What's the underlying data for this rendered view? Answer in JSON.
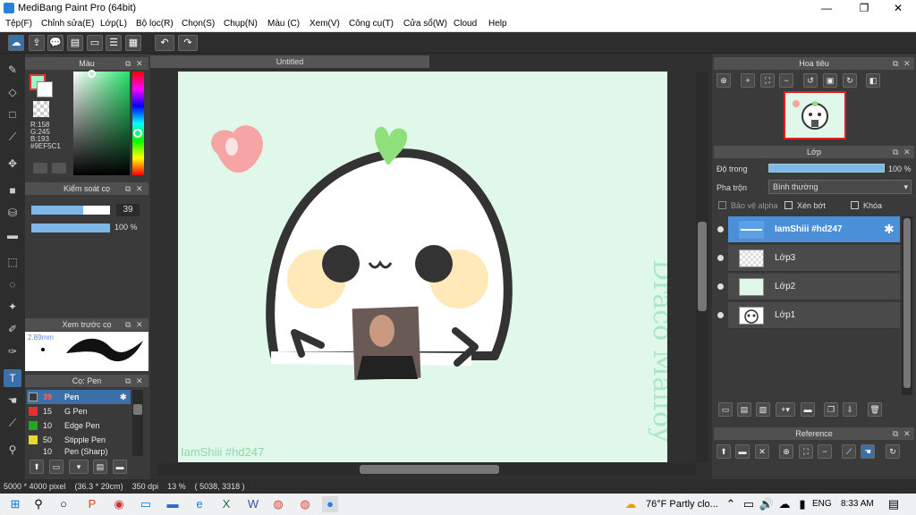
{
  "window": {
    "title": "MediBang Paint Pro (64bit)",
    "minimize": "—",
    "restore": "❐",
    "close": "✕"
  },
  "menu": [
    "Tệp(F)",
    "Chỉnh sửa(E)",
    "Lớp(L)",
    "Bộ lọc(R)",
    "Chọn(S)",
    "Chụp(N)",
    "Màu (C)",
    "Xem(V)",
    "Công cụ(T)",
    "Cửa sổ(W)",
    "Cloud",
    "Help"
  ],
  "color_panel": {
    "title": "Màu",
    "r": "R:158",
    "g": "G:245",
    "b": "B:193",
    "hex": "#9EF5C1",
    "accent": "#9ef5c1"
  },
  "control_panel": {
    "title": "Kiểm soát cọ",
    "size_value": "39",
    "opacity_value": "100 %"
  },
  "preview_panel": {
    "title": "Xem trước cọ",
    "size": "2.89mm"
  },
  "brush_panel": {
    "title": "Cọ: Pen",
    "items": [
      {
        "size": "39",
        "name": "Pen",
        "color": "#3b3b3b"
      },
      {
        "size": "15",
        "name": "G Pen",
        "color": "#e53030"
      },
      {
        "size": "10",
        "name": "Edge Pen",
        "color": "#22a822"
      },
      {
        "size": "50",
        "name": "Stipple Pen",
        "color": "#e8d830"
      },
      {
        "size": "10",
        "name": "Pen (Sharp)",
        "color": "#3b3b3b"
      }
    ]
  },
  "document": {
    "tab": "Untitled",
    "signature": "IamShiii #hd247",
    "watermark": "Draco Malfoy"
  },
  "navigator": {
    "title": "Hoa tiêu"
  },
  "layers_panel": {
    "title": "Lớp",
    "opacity_label": "Độ trong",
    "opacity_value": "100 %",
    "blend_label": "Pha trộn",
    "blend_value": "Bình thường",
    "protect_alpha": "Bảo vệ alpha",
    "clipping": "Xén bớt",
    "lock": "Khóa",
    "layers": [
      {
        "name": "IamShiii #hd247",
        "selected": true
      },
      {
        "name": "Lớp3",
        "selected": false
      },
      {
        "name": "Lớp2",
        "selected": false
      },
      {
        "name": "Lớp1",
        "selected": false
      }
    ]
  },
  "reference_panel": {
    "title": "Reference"
  },
  "status": {
    "text": "5000 * 4000 pixel    (36.3 * 29cm)    350 dpi    13 %    ( 5038, 3318 )"
  },
  "taskbar": {
    "weather": "76°F  Partly clo...",
    "lang": "ENG",
    "time": "8:33 AM"
  }
}
